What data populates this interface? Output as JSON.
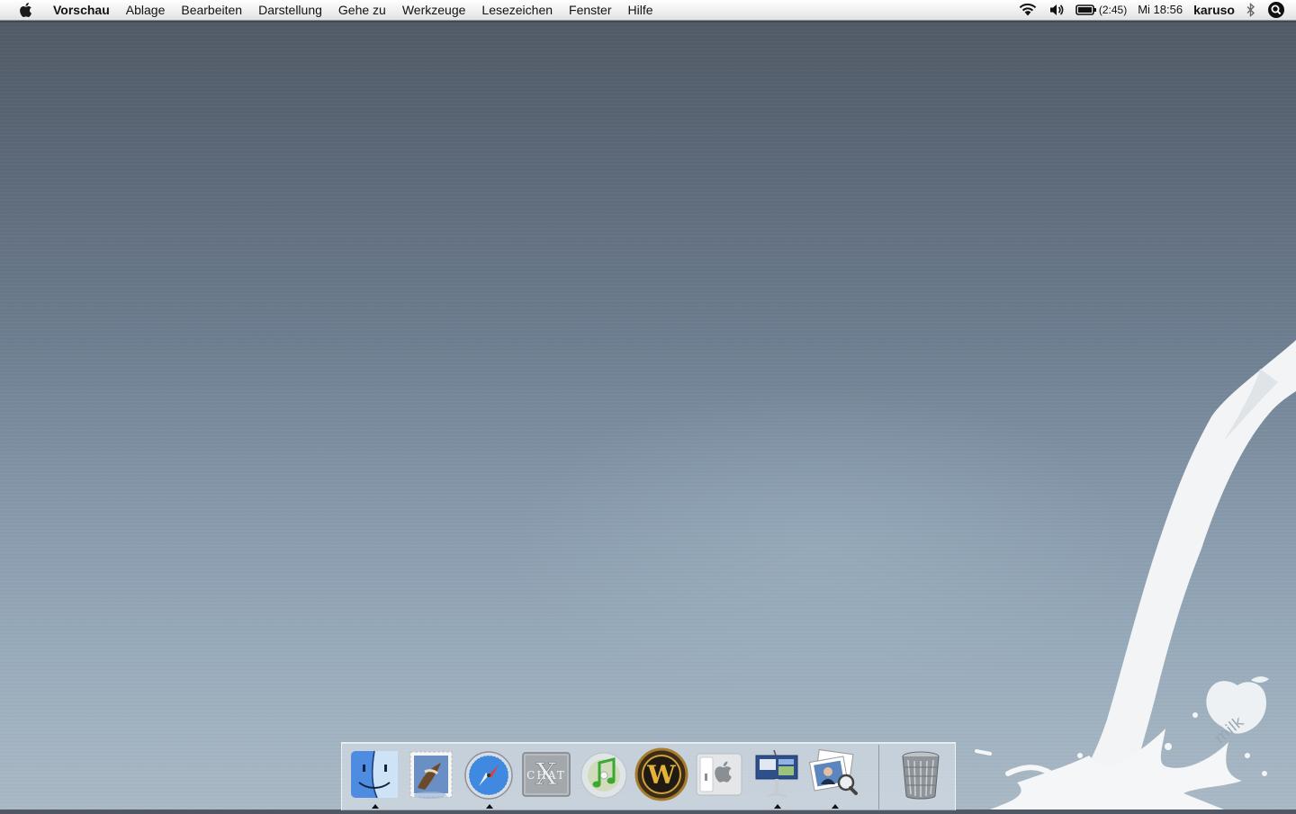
{
  "menubar": {
    "apple_icon": "apple-icon",
    "app_name": "Vorschau",
    "items": [
      "Ablage",
      "Bearbeiten",
      "Darstellung",
      "Gehe zu",
      "Werkzeuge",
      "Lesezeichen",
      "Fenster",
      "Hilfe"
    ],
    "status": {
      "wifi_icon": "wifi-icon",
      "volume_icon": "volume-icon",
      "battery_icon": "battery-icon",
      "battery_time": "(2:45)",
      "clock": "Mi 18:56",
      "user": "karuso",
      "bluetooth_icon": "bluetooth-icon",
      "spotlight_icon": "spotlight-icon"
    }
  },
  "desktop": {
    "wallpaper_logo_text": "milk"
  },
  "dock": {
    "items": [
      {
        "name": "finder",
        "icon": "finder-icon",
        "running": true
      },
      {
        "name": "mail",
        "icon": "mail-icon",
        "running": false
      },
      {
        "name": "safari",
        "icon": "safari-icon",
        "running": true
      },
      {
        "name": "chat",
        "icon": "chat-icon",
        "running": false
      },
      {
        "name": "itunes",
        "icon": "itunes-icon",
        "running": false
      },
      {
        "name": "world-of-warcraft",
        "icon": "warcraft-icon",
        "running": false
      },
      {
        "name": "system-preferences",
        "icon": "switch-icon",
        "running": false
      },
      {
        "name": "keynote",
        "icon": "keynote-icon",
        "running": true
      },
      {
        "name": "preview",
        "icon": "preview-icon",
        "running": true
      },
      {
        "name": "trash",
        "icon": "trash-icon",
        "running": false
      }
    ],
    "chat_icon_text": "CHAT"
  },
  "colors": {
    "wallpaper_top": "#4f5864",
    "wallpaper_bottom": "#aab9c6",
    "menubar": "#f1f1f1",
    "milk": "#f4f6f7"
  }
}
